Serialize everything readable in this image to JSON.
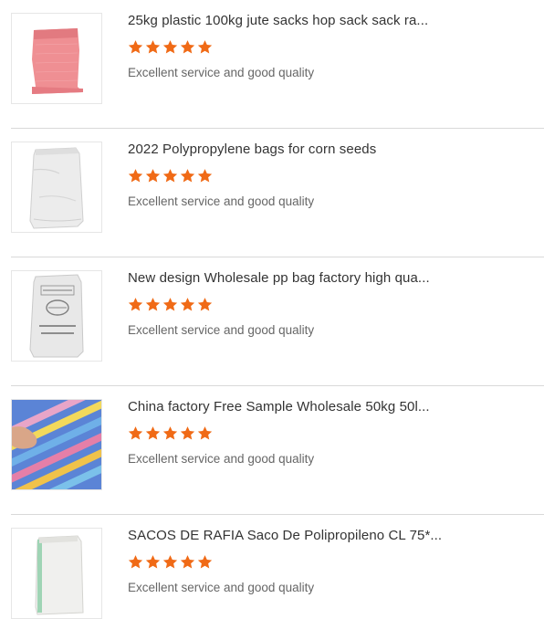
{
  "colors": {
    "star": "#f06a16",
    "divider": "#d9d9d9",
    "title": "#333333",
    "review": "#666666"
  },
  "products": [
    {
      "thumb_icon": "pink-woven-sack-image",
      "title": "25kg plastic 100kg jute sacks hop sack sack ra...",
      "rating": 5,
      "review": "Excellent service and good quality"
    },
    {
      "thumb_icon": "white-pp-bag-image",
      "title": "2022 Polypropylene bags for corn seeds",
      "rating": 5,
      "review": "Excellent service and good quality"
    },
    {
      "thumb_icon": "printed-pp-bag-image",
      "title": "New design Wholesale pp bag factory high qua...",
      "rating": 5,
      "review": "Excellent service and good quality"
    },
    {
      "thumb_icon": "striped-woven-bag-image",
      "title": "China factory Free Sample Wholesale 50kg 50l...",
      "rating": 5,
      "review": "Excellent service and good quality"
    },
    {
      "thumb_icon": "white-raffia-sack-image",
      "title": "SACOS DE RAFIA Saco De Polipropileno CL 75*...",
      "rating": 5,
      "review": "Excellent service and good quality"
    }
  ]
}
